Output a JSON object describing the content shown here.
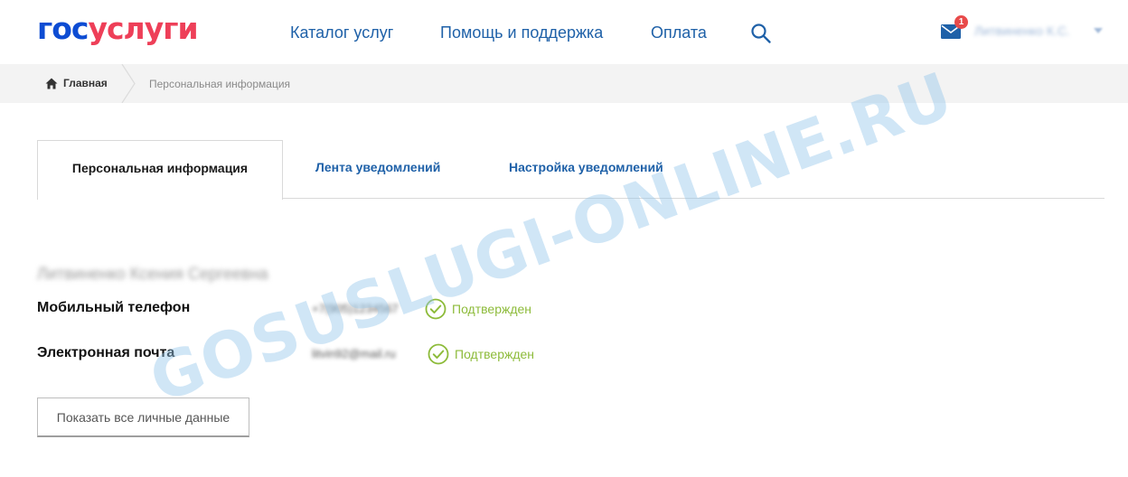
{
  "header": {
    "logo": {
      "part1": "гос",
      "part2": "услуги"
    },
    "nav": {
      "catalog": "Каталог услуг",
      "help": "Помощь и поддержка",
      "payment": "Оплата"
    },
    "notifications_count": "1",
    "user_name": "Литвиненко К.С."
  },
  "breadcrumb": {
    "home": "Главная",
    "current": "Персональная информация"
  },
  "tabs": {
    "personal": "Персональная информация",
    "feed": "Лента уведомлений",
    "settings": "Настройка уведомлений"
  },
  "profile": {
    "full_name": "Литвиненко Ксения Сергеевна",
    "phone": {
      "label": "Мобильный телефон",
      "value": "+7(905)1234567",
      "status": "Подтвержден"
    },
    "email": {
      "label": "Электронная почта",
      "value": "litvin92@mail.ru",
      "status": "Подтвержден"
    },
    "show_all_button": "Показать все личные данные"
  },
  "watermark": "GOSUSLUGI-ONLINE.RU",
  "colors": {
    "brand_blue": "#0d4cd3",
    "brand_red": "#ee3f58",
    "link_blue": "#1f61a8",
    "confirmed_green": "#8dbb3a",
    "breadcrumb_bg": "#f3f3f3"
  }
}
